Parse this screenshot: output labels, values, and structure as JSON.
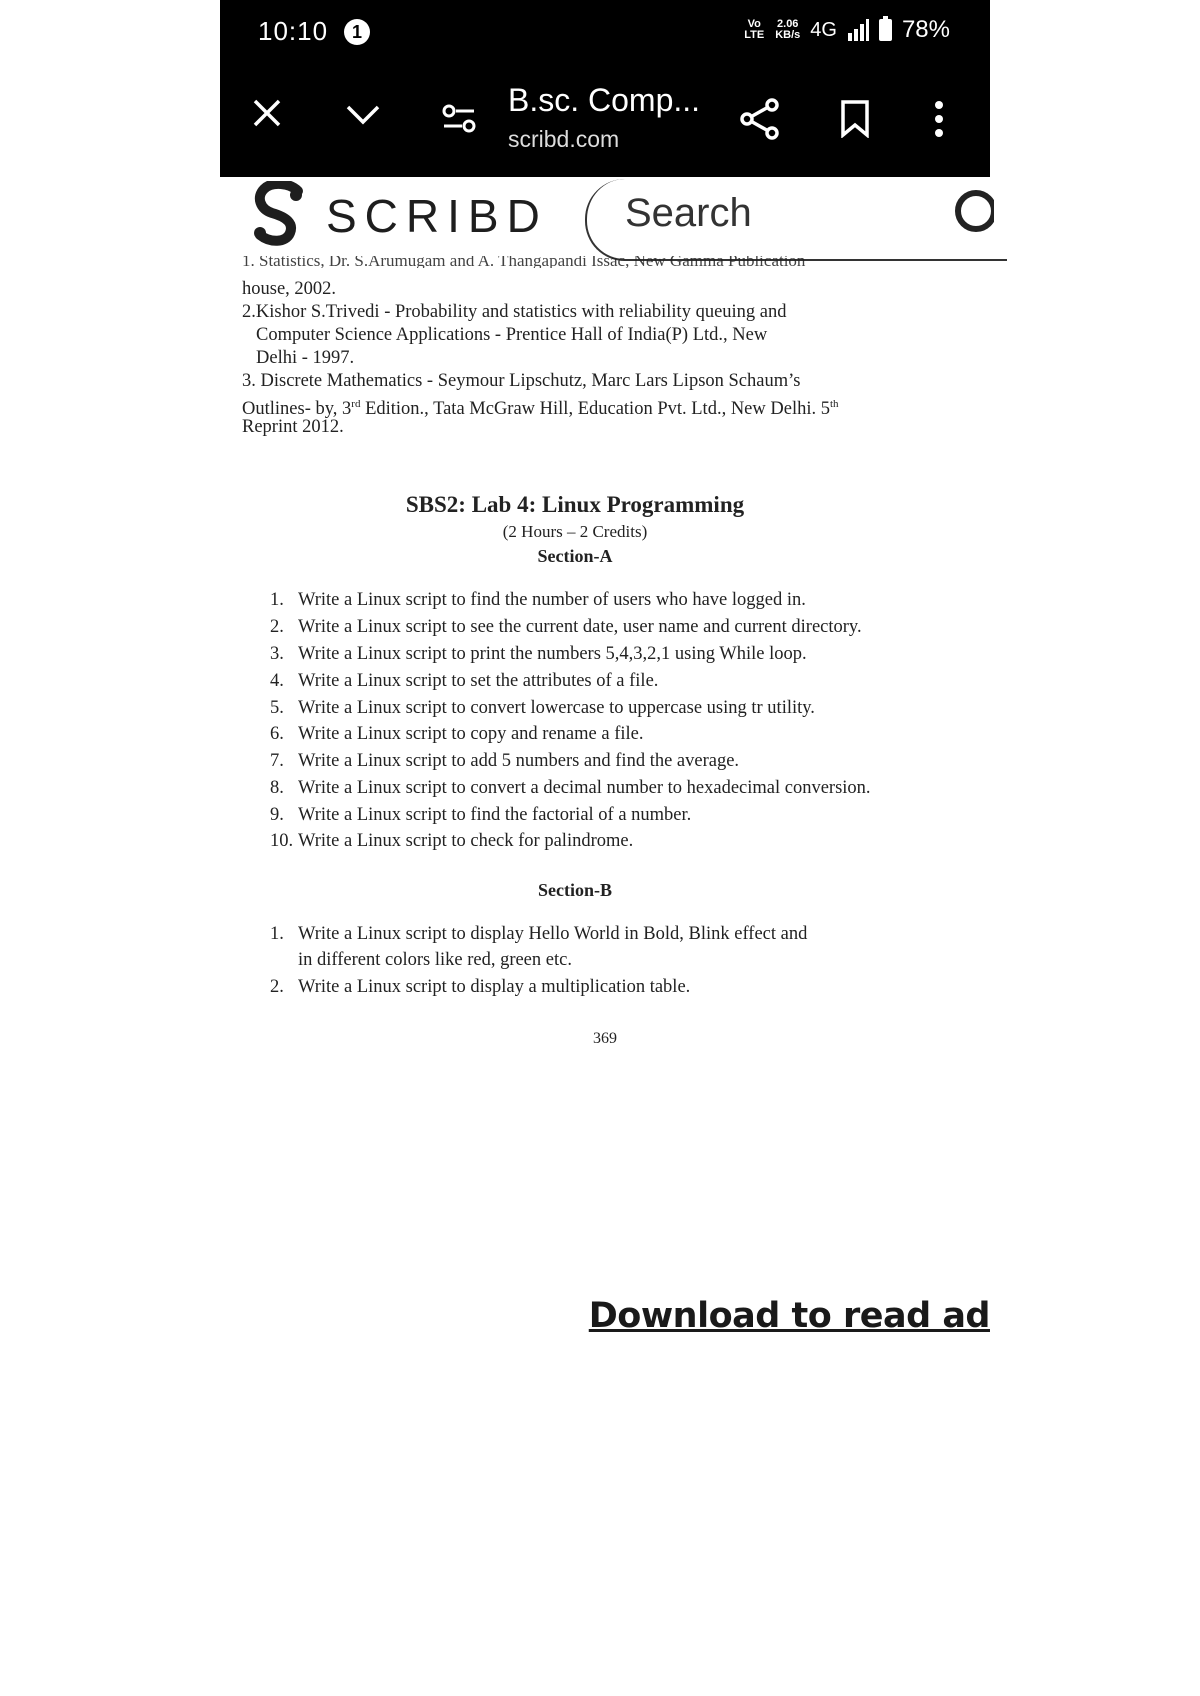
{
  "status_bar": {
    "time": "10:10",
    "notification_count": "1",
    "volte": "Vo LTE",
    "speed_value": "2.06",
    "speed_unit": "KB/s",
    "network": "4G",
    "battery": "78%"
  },
  "browser": {
    "page_title": "B.sc. Comp...",
    "url": "scribd.com",
    "icons": [
      "close-icon",
      "chevron-down-icon",
      "tune-icon",
      "share-icon",
      "bookmark-icon",
      "more-vert-icon"
    ]
  },
  "scribd": {
    "brand": "SCRIBD",
    "search_placeholder": "Search"
  },
  "document": {
    "refs_cut_line": "1. Statistics, Dr. S.Arumugam and A. Thangapandi Issac, New Gamma Publication",
    "ref1_cont": "house, 2002.",
    "ref2_line1": "2.Kishor S.Trivedi - Probability and statistics with reliability queuing and",
    "ref2_line2": "Computer Science Applications - Prentice Hall of India(P) Ltd., New",
    "ref2_line3": "Delhi - 1997.",
    "ref3_line1": "3. Discrete Mathematics - Seymour Lipschutz, Marc Lars Lipson Schaum’s",
    "ref3_line2_a": "Outlines- by, 3",
    "ref3_line2_sup": "rd",
    "ref3_line2_b": " Edition., Tata McGraw Hill, Education Pvt. Ltd., New Delhi. 5",
    "ref3_line2_sup2": "th",
    "ref3_line3": "Reprint 2012.",
    "lab_title": "SBS2: Lab 4: Linux Programming",
    "lab_hours": "(2 Hours – 2 Credits)",
    "section_a": "Section-A",
    "section_a_items": [
      {
        "num": "1.",
        "text": "Write a Linux script to find the number of users who have logged in."
      },
      {
        "num": "2.",
        "text": "Write a Linux script to see the current date, user name and current directory."
      },
      {
        "num": "3.",
        "text": "Write a Linux script to print the numbers 5,4,3,2,1 using While loop."
      },
      {
        "num": "4.",
        "text": "Write a Linux script to set the attributes of a file."
      },
      {
        "num": "5.",
        "text": "Write a Linux script to convert lowercase to uppercase using tr utility."
      },
      {
        "num": "6.",
        "text": "Write a Linux script to copy and rename a file."
      },
      {
        "num": "7.",
        "text": "Write a Linux script to add 5 numbers and find the average."
      },
      {
        "num": "8.",
        "text": "Write a Linux script to convert a decimal number to hexadecimal conversion."
      },
      {
        "num": "9.",
        "text": "Write a Linux script to find the factorial of a number."
      },
      {
        "num": "10.",
        "text": "Write a Linux script to check for palindrome."
      }
    ],
    "section_b": "Section-B",
    "section_b_item1_line1": "Write a Linux script to display Hello World in Bold, Blink effect and",
    "section_b_item1_line2": "in different colors like red, green etc.",
    "section_b_item1_num": "1.",
    "section_b_item2_num": "2.",
    "section_b_item2": "Write a Linux script to display a multiplication table.",
    "page_number": "369"
  },
  "download_link": "Download to read ad"
}
